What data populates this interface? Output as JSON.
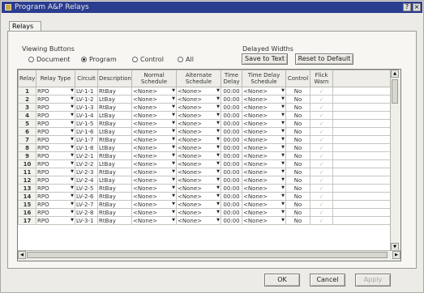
{
  "window": {
    "title": "Program A&P Relays"
  },
  "tabs": [
    {
      "label": "Relays"
    }
  ],
  "viewing_buttons": {
    "label": "Viewing Buttons",
    "options": [
      {
        "label": "Document",
        "selected": false
      },
      {
        "label": "Program",
        "selected": true
      },
      {
        "label": "Control",
        "selected": false
      },
      {
        "label": "All",
        "selected": false
      }
    ]
  },
  "delayed_widths": {
    "label": "Delayed Widths",
    "save_label": "Save to Text",
    "reset_label": "Reset to Default"
  },
  "table": {
    "headers": [
      "Relay",
      "Relay Type",
      "Circuit",
      "Description",
      "Normal Schedule",
      "Alternate Schedule",
      "Time Delay",
      "Time Delay Schedule",
      "Control",
      "Flick Warn"
    ],
    "rows": [
      {
        "relay": "1",
        "type": "RPO",
        "circuit": "LV-1-1",
        "description": "RtBay",
        "normal": "<None>",
        "alternate": "<None>",
        "delay": "00:00",
        "delay_schedule": "<None>",
        "control": "No"
      },
      {
        "relay": "2",
        "type": "RPO",
        "circuit": "LV-1-2",
        "description": "LtBay",
        "normal": "<None>",
        "alternate": "<None>",
        "delay": "00:00",
        "delay_schedule": "<None>",
        "control": "No"
      },
      {
        "relay": "3",
        "type": "RPO",
        "circuit": "LV-1-3",
        "description": "RtBay",
        "normal": "<None>",
        "alternate": "<None>",
        "delay": "00:00",
        "delay_schedule": "<None>",
        "control": "No"
      },
      {
        "relay": "4",
        "type": "RPO",
        "circuit": "LV-1-4",
        "description": "LtBay",
        "normal": "<None>",
        "alternate": "<None>",
        "delay": "00:00",
        "delay_schedule": "<None>",
        "control": "No"
      },
      {
        "relay": "5",
        "type": "RPO",
        "circuit": "LV-1-5",
        "description": "RtBay",
        "normal": "<None>",
        "alternate": "<None>",
        "delay": "00:00",
        "delay_schedule": "<None>",
        "control": "No"
      },
      {
        "relay": "6",
        "type": "RPO",
        "circuit": "LV-1-6",
        "description": "LtBay",
        "normal": "<None>",
        "alternate": "<None>",
        "delay": "00:00",
        "delay_schedule": "<None>",
        "control": "No"
      },
      {
        "relay": "7",
        "type": "RPO",
        "circuit": "LV-1-7",
        "description": "RtBay",
        "normal": "<None>",
        "alternate": "<None>",
        "delay": "00:00",
        "delay_schedule": "<None>",
        "control": "No"
      },
      {
        "relay": "8",
        "type": "RPO",
        "circuit": "LV-1-8",
        "description": "LtBay",
        "normal": "<None>",
        "alternate": "<None>",
        "delay": "00:00",
        "delay_schedule": "<None>",
        "control": "No"
      },
      {
        "relay": "9",
        "type": "RPO",
        "circuit": "LV-2-1",
        "description": "RtBay",
        "normal": "<None>",
        "alternate": "<None>",
        "delay": "00:00",
        "delay_schedule": "<None>",
        "control": "No"
      },
      {
        "relay": "10",
        "type": "RPO",
        "circuit": "LV-2-2",
        "description": "LtBay",
        "normal": "<None>",
        "alternate": "<None>",
        "delay": "00:00",
        "delay_schedule": "<None>",
        "control": "No"
      },
      {
        "relay": "11",
        "type": "RPO",
        "circuit": "LV-2-3",
        "description": "RtBay",
        "normal": "<None>",
        "alternate": "<None>",
        "delay": "00:00",
        "delay_schedule": "<None>",
        "control": "No"
      },
      {
        "relay": "12",
        "type": "RPO",
        "circuit": "LV-2-4",
        "description": "LtBay",
        "normal": "<None>",
        "alternate": "<None>",
        "delay": "00:00",
        "delay_schedule": "<None>",
        "control": "No"
      },
      {
        "relay": "13",
        "type": "RPO",
        "circuit": "LV-2-5",
        "description": "RtBay",
        "normal": "<None>",
        "alternate": "<None>",
        "delay": "00:00",
        "delay_schedule": "<None>",
        "control": "No"
      },
      {
        "relay": "14",
        "type": "RPO",
        "circuit": "LV-2-6",
        "description": "RtBay",
        "normal": "<None>",
        "alternate": "<None>",
        "delay": "00:00",
        "delay_schedule": "<None>",
        "control": "No"
      },
      {
        "relay": "15",
        "type": "RPO",
        "circuit": "LV-2-7",
        "description": "RtBay",
        "normal": "<None>",
        "alternate": "<None>",
        "delay": "00:00",
        "delay_schedule": "<None>",
        "control": "No"
      },
      {
        "relay": "16",
        "type": "RPO",
        "circuit": "LV-2-8",
        "description": "RtBay",
        "normal": "<None>",
        "alternate": "<None>",
        "delay": "00:00",
        "delay_schedule": "<None>",
        "control": "No"
      },
      {
        "relay": "17",
        "type": "RPO",
        "circuit": "LV-3-1",
        "description": "RtBay",
        "normal": "<None>",
        "alternate": "<None>",
        "delay": "00:00",
        "delay_schedule": "<None>",
        "control": "No"
      }
    ]
  },
  "footer": {
    "ok_label": "OK",
    "cancel_label": "Cancel",
    "apply_label": "Apply"
  }
}
